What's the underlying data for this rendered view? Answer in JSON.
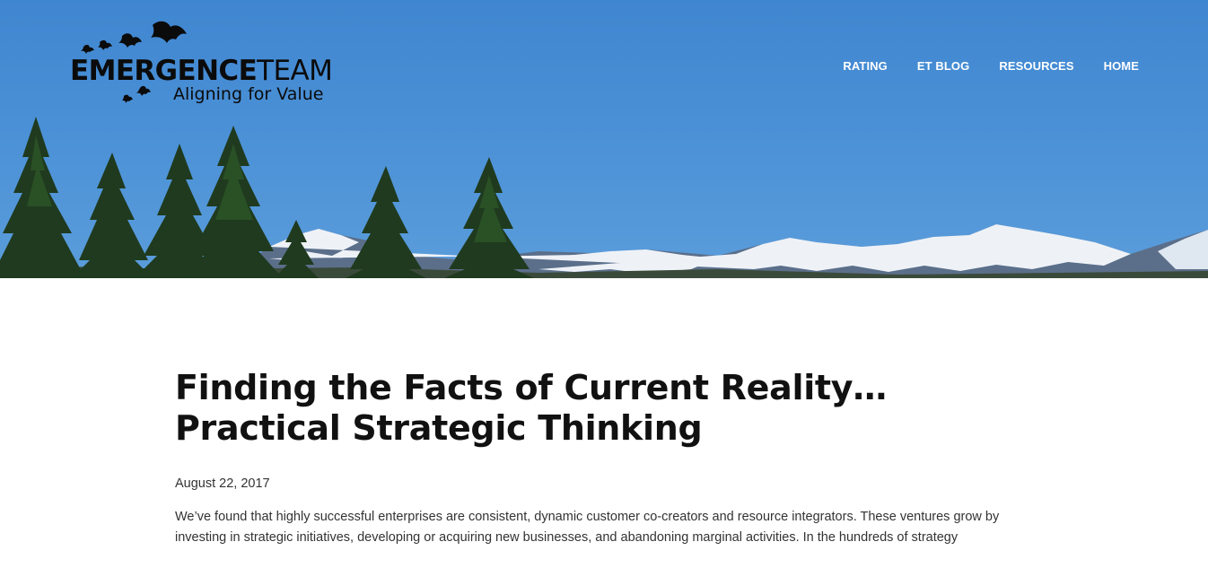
{
  "brand": {
    "name_bold": "EMERGENCE",
    "name_light": "TEAM",
    "tagline": "Aligning for Value",
    "logo_icon": "flying-birds-icon"
  },
  "nav": {
    "items": [
      {
        "label": "RATING"
      },
      {
        "label": "ET BLOG"
      },
      {
        "label": "RESOURCES"
      },
      {
        "label": "HOME"
      }
    ]
  },
  "hero": {
    "scene": "mountain-and-pine-trees-banner",
    "sky_color": "#4a90d6"
  },
  "article": {
    "title": "Finding the Facts of Current Reality…Practical Strategic Thinking",
    "date": "August 22, 2017",
    "body": "We’ve found that highly successful enterprises are consistent, dynamic customer co-creators and resource integrators. These ventures grow by investing in strategic initiatives, developing or acquiring new businesses, and abandoning marginal activities. In the hundreds of strategy"
  }
}
